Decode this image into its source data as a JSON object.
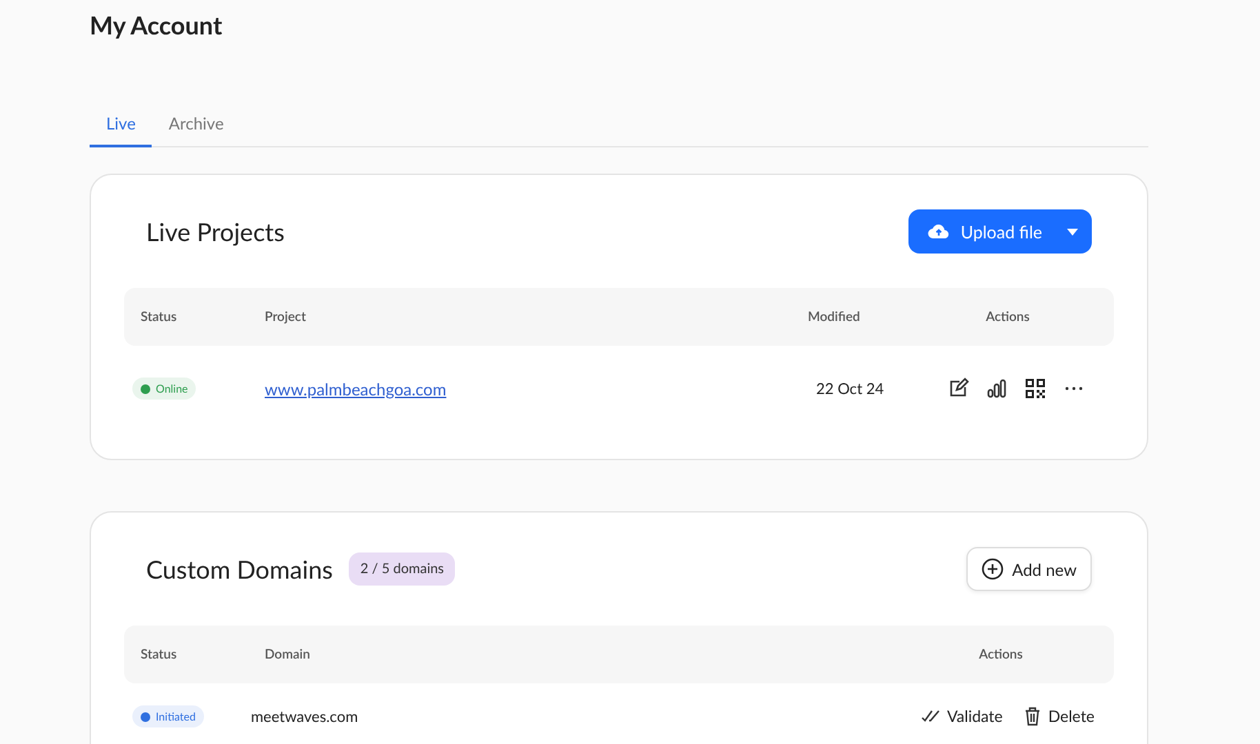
{
  "page": {
    "title": "My Account"
  },
  "tabs": [
    {
      "label": "Live",
      "selected": true
    },
    {
      "label": "Archive",
      "selected": false
    }
  ],
  "live_projects": {
    "title": "Live Projects",
    "upload_button": "Upload file",
    "columns": [
      "Status",
      "Project",
      "Modified",
      "Actions"
    ],
    "rows": [
      {
        "status": "Online",
        "color": "#2e9e4f",
        "project": "www.palmbeachgoa.com",
        "modified": "22 Oct 24"
      }
    ]
  },
  "custom_domains": {
    "title": "Custom Domains",
    "count_badge": "2 / 5 domains",
    "add_button": "Add new",
    "columns": [
      "Status",
      "Domain",
      "Actions"
    ],
    "rows": [
      {
        "status": "Initiated",
        "color": "#2f6fe0",
        "domain": "meetwaves.com",
        "validate": "Validate",
        "delete": "Delete"
      }
    ]
  }
}
